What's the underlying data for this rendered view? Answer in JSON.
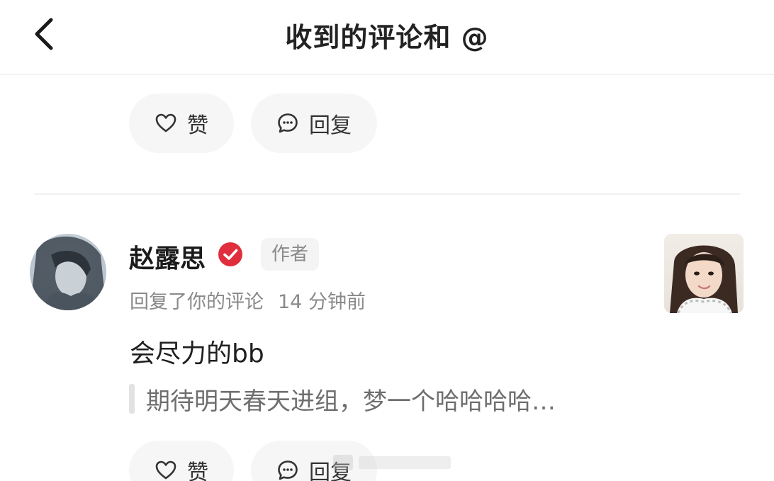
{
  "header": {
    "title": "收到的评论和 @"
  },
  "top_actions": {
    "like_label": "赞",
    "reply_label": "回复"
  },
  "notification": {
    "username": "赵露思",
    "author_tag": "作者",
    "action": "回复了你的评论",
    "time": "14 分钟前",
    "reply_text": "会尽力的bb",
    "quoted_comment": "期待明天春天进组，梦一个哈哈哈哈…",
    "like_label": "赞",
    "reply_label": "回复"
  },
  "icons": {
    "back": "chevron-left-icon",
    "like": "heart-icon",
    "reply": "comment-bubble-icon",
    "verified": "verified-check-icon"
  },
  "colors": {
    "verified_badge": "#e02e3c",
    "secondary_text": "#8a8a8a",
    "pill_background": "#f6f6f6"
  }
}
